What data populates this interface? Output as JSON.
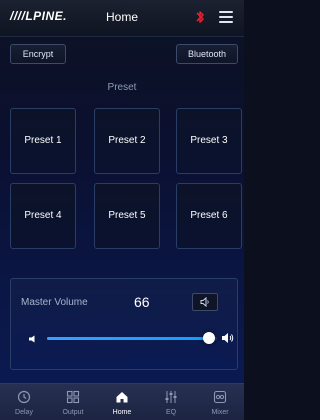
{
  "header": {
    "logo": "////LPINE.",
    "title": "Home"
  },
  "buttons": {
    "encrypt": "Encrypt",
    "bluetooth": "Bluetooth"
  },
  "preset_section": {
    "label": "Preset",
    "items": [
      "Preset 1",
      "Preset 2",
      "Preset 3",
      "Preset 4",
      "Preset 5",
      "Preset 6"
    ]
  },
  "volume": {
    "label": "Master Volume",
    "value": "66",
    "level_fraction": 0.95
  },
  "nav": {
    "items": [
      {
        "label": "Delay",
        "icon": "clock-icon",
        "active": false
      },
      {
        "label": "Output",
        "icon": "grid-icon",
        "active": false
      },
      {
        "label": "Home",
        "icon": "home-icon",
        "active": true
      },
      {
        "label": "EQ",
        "icon": "eq-sliders-icon",
        "active": false
      },
      {
        "label": "Mixer",
        "icon": "mixer-icon",
        "active": false
      }
    ]
  },
  "colors": {
    "accent": "#0ea0ff",
    "bluetooth": "#e0202e",
    "background": "#0a1645"
  }
}
